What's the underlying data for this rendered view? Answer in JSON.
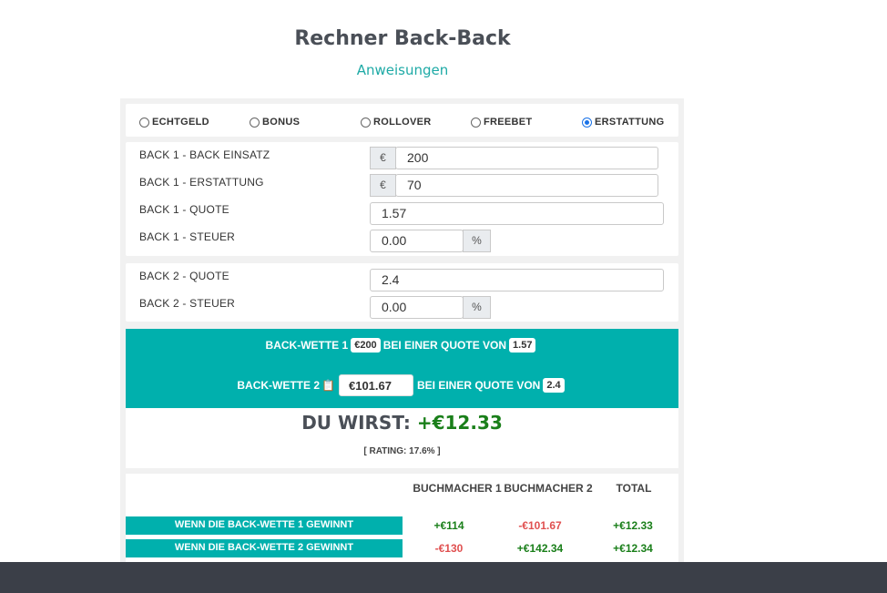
{
  "header": {
    "title": "Rechner Back-Back",
    "instructions_link": "Anweisungen"
  },
  "modes": [
    {
      "label": "ECHTGELD",
      "selected": false
    },
    {
      "label": "BONUS",
      "selected": false
    },
    {
      "label": "ROLLOVER",
      "selected": false
    },
    {
      "label": "FREEBET",
      "selected": false
    },
    {
      "label": "ERSTATTUNG",
      "selected": true
    }
  ],
  "back1": {
    "stake_label": "BACK 1 - BACK EINSATZ",
    "currency": "€",
    "stake_value": "200",
    "refund_label": "BACK 1 - ERSTATTUNG",
    "refund_value": "70",
    "odds_label": "BACK 1 - QUOTE",
    "odds_value": "1.57",
    "tax_label": "BACK 1 - STEUER",
    "tax_value": "0.00",
    "tax_unit": "%"
  },
  "back2": {
    "odds_label": "BACK 2 - QUOTE",
    "odds_value": "2.4",
    "tax_label": "BACK 2 - STEUER",
    "tax_value": "0.00",
    "tax_unit": "%"
  },
  "summary": {
    "bet1_label": "BACK-WETTE 1",
    "bet1_stake": "€200",
    "at_odds_label": "BEI EINER QUOTE VON",
    "bet1_odds": "1.57",
    "bet2_label": "BACK-WETTE 2",
    "bet2_stake": "€101.67",
    "bet2_odds": "2.4",
    "copy_icon": "clipboard-icon",
    "you_will_label": "DU WIRST:",
    "you_will_value": "+€12.33",
    "rating": "[ RATING: 17.6% ]"
  },
  "table": {
    "headers": [
      "BUCHMACHER 1",
      "BUCHMACHER 2",
      "TOTAL"
    ],
    "rows": [
      {
        "label": "WENN DIE BACK-WETTE 1 GEWINNT",
        "b1": "+€114",
        "b2": "-€101.67",
        "total": "+€12.33"
      },
      {
        "label": "WENN DIE BACK-WETTE 2 GEWINNT",
        "b1": "-€130",
        "b2": "+€142.34",
        "total": "+€12.34"
      }
    ]
  },
  "colors": {
    "teal": "#00b0ad",
    "positive": "#1a7f1a",
    "negative": "#e05050",
    "footer": "#3b3f48"
  }
}
